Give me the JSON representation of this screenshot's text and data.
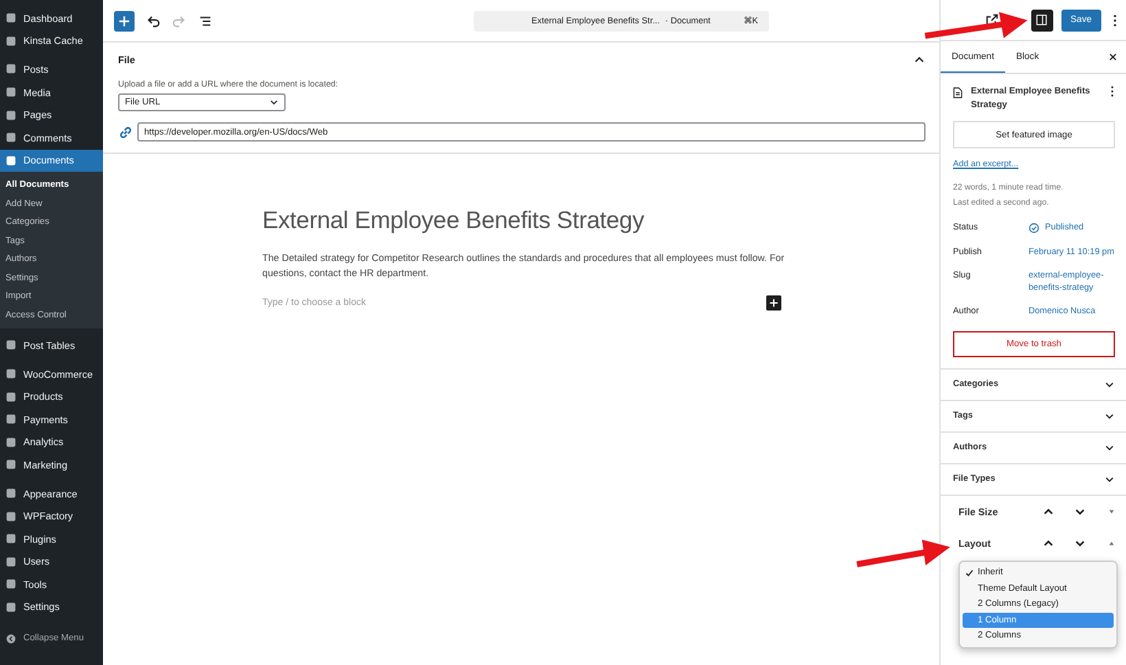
{
  "sidebar": {
    "groups": [
      [
        {
          "label": "Dashboard",
          "selected": false
        },
        {
          "label": "Kinsta Cache",
          "selected": false
        }
      ],
      [
        {
          "label": "Posts",
          "selected": false
        },
        {
          "label": "Media",
          "selected": false
        },
        {
          "label": "Pages",
          "selected": false
        },
        {
          "label": "Comments",
          "selected": false
        },
        {
          "label": "Documents",
          "selected": true,
          "children": [
            {
              "label": "All Documents",
              "selected": true
            },
            {
              "label": "Add New",
              "selected": false
            },
            {
              "label": "Categories",
              "selected": false
            },
            {
              "label": "Tags",
              "selected": false
            },
            {
              "label": "Authors",
              "selected": false
            },
            {
              "label": "Settings",
              "selected": false
            },
            {
              "label": "Import",
              "selected": false
            },
            {
              "label": "Access Control",
              "selected": false
            }
          ]
        }
      ],
      [
        {
          "label": "Post Tables",
          "selected": false
        }
      ],
      [
        {
          "label": "WooCommerce",
          "selected": false
        },
        {
          "label": "Products",
          "selected": false
        },
        {
          "label": "Payments",
          "selected": false
        },
        {
          "label": "Analytics",
          "selected": false
        },
        {
          "label": "Marketing",
          "selected": false
        }
      ],
      [
        {
          "label": "Appearance",
          "selected": false
        },
        {
          "label": "WPFactory",
          "selected": false
        },
        {
          "label": "Plugins",
          "selected": false
        },
        {
          "label": "Users",
          "selected": false
        },
        {
          "label": "Tools",
          "selected": false
        },
        {
          "label": "Settings",
          "selected": false
        }
      ]
    ],
    "collapse": "Collapse Menu"
  },
  "toolbar": {
    "doc_title": "External Employee Benefits Str...",
    "doc_type": "· Document",
    "shortcut": "⌘K",
    "redo_disabled": true,
    "settings_on": true,
    "save": "Save"
  },
  "file_panel": {
    "title": "File",
    "expanded": true,
    "hint": "Upload a file or add a URL where the document is located:",
    "source": "File URL",
    "url": "https://developer.mozilla.org/en-US/docs/Web"
  },
  "content": {
    "title": "External Employee Benefits Strategy",
    "paragraph": "The Detailed strategy for Competitor Research outlines the standards and procedures that all employees must follow. For questions, contact the HR department.",
    "placeholder": "Type / to choose a block"
  },
  "settings": {
    "tabs": [
      {
        "label": "Document",
        "selected": true
      },
      {
        "label": "Block",
        "selected": false
      }
    ],
    "doc_title": "External Employee Benefits Strategy",
    "featured_button": "Set featured image",
    "excerpt_link": "Add an excerpt...",
    "stats": [
      "22 words, 1 minute read time.",
      "Last edited a second ago."
    ],
    "meta": [
      {
        "label": "Status",
        "kind": "status",
        "value": "Published"
      },
      {
        "label": "Publish",
        "kind": "link",
        "value": "February 11 10:19 pm"
      },
      {
        "label": "Slug",
        "kind": "link",
        "value": "external-employee-benefits-strategy"
      },
      {
        "label": "Author",
        "kind": "link",
        "value": "Domenico Nusca"
      }
    ],
    "trash": "Move to trash",
    "panels": [
      {
        "title": "Categories",
        "kind": "collapsible",
        "expanded": false
      },
      {
        "title": "Tags",
        "kind": "collapsible",
        "expanded": false
      },
      {
        "title": "Authors",
        "kind": "collapsible",
        "expanded": false
      },
      {
        "title": "File Types",
        "kind": "collapsible",
        "expanded": false
      },
      {
        "title": "File Size",
        "kind": "movable",
        "expanded": false
      },
      {
        "title": "Layout",
        "kind": "movable",
        "expanded": true
      }
    ]
  },
  "layout_menu": {
    "options": [
      {
        "label": "Inherit",
        "checked": true,
        "selected": false
      },
      {
        "label": "Theme Default Layout",
        "checked": false,
        "selected": false
      },
      {
        "label": "2 Columns (Legacy)",
        "checked": false,
        "selected": false
      },
      {
        "label": "1 Column",
        "checked": false,
        "selected": true
      },
      {
        "label": "2 Columns",
        "checked": false,
        "selected": false
      }
    ]
  }
}
